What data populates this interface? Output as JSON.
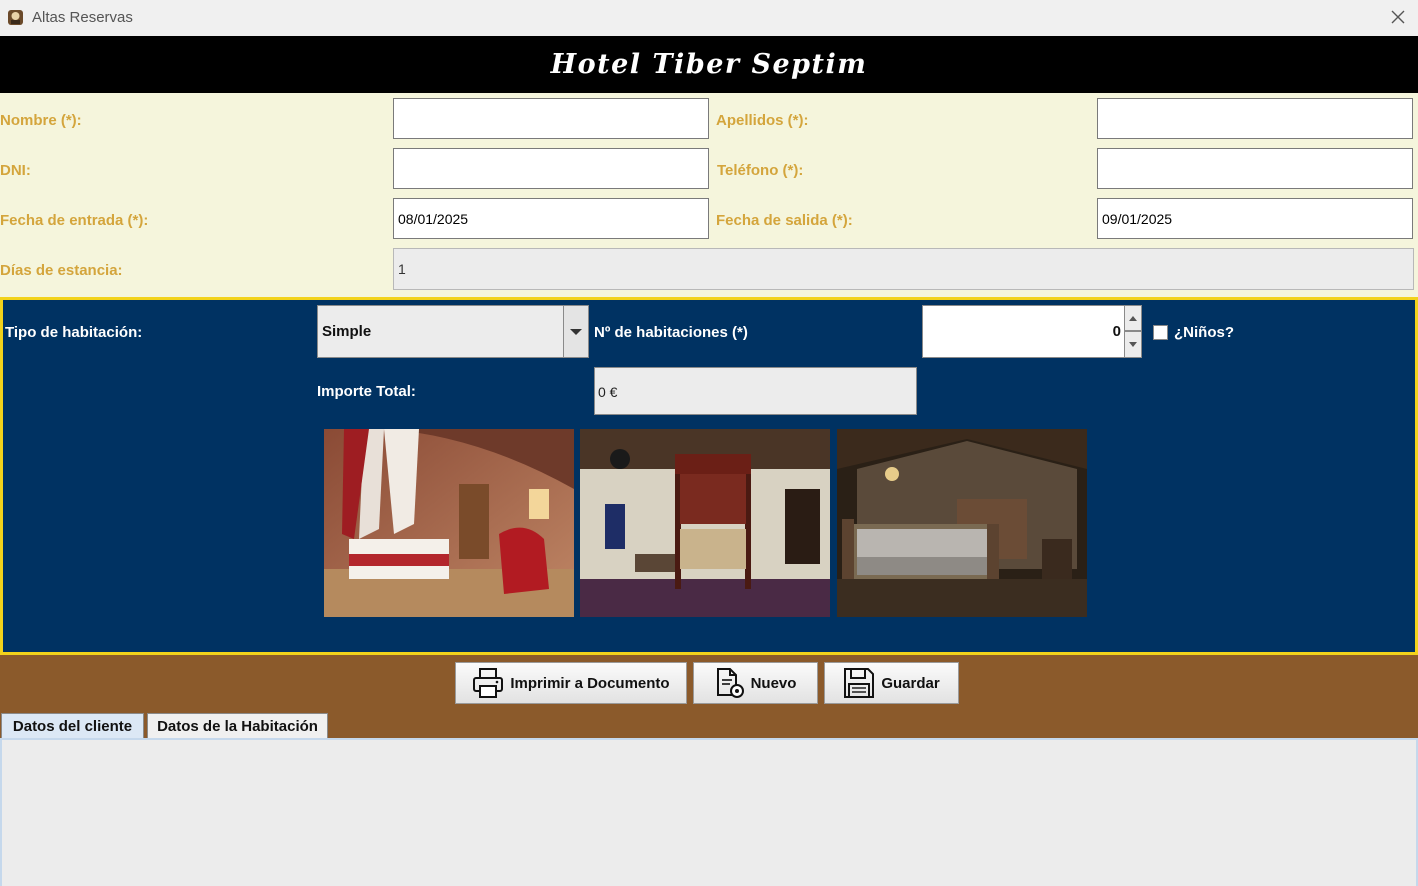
{
  "window": {
    "title": "Altas Reservas"
  },
  "header": {
    "hotel_name": "Hotel Tiber Septim"
  },
  "client": {
    "nombre_label": "Nombre (*):",
    "nombre_value": "",
    "apellidos_label": "Apellidos (*):",
    "apellidos_value": "",
    "dni_label": "DNI:",
    "dni_value": "",
    "telefono_label": "Teléfono (*):",
    "telefono_value": "",
    "fecha_entrada_label": "Fecha de entrada (*):",
    "fecha_entrada_value": "08/01/2025",
    "fecha_salida_label": "Fecha de salida (*):",
    "fecha_salida_value": "09/01/2025",
    "dias_label": "Días de estancia:",
    "dias_value": "1"
  },
  "room": {
    "tipo_label": "Tipo de habitación:",
    "tipo_value": "Simple",
    "num_label": "Nº de habitaciones (*)",
    "num_value": "0",
    "ninos_label": "¿Niños?",
    "ninos_checked": false,
    "importe_label": "Importe Total:",
    "importe_value": "0 €"
  },
  "buttons": {
    "print_label": "Imprimir a Documento",
    "new_label": "Nuevo",
    "save_label": "Guardar"
  },
  "tabs": [
    {
      "label": "Datos del cliente",
      "active": true
    },
    {
      "label": "Datos de la Habitación",
      "active": false
    }
  ],
  "colors": {
    "header_bg": "#000000",
    "client_panel_bg": "#f5f5dc",
    "client_label": "#d4a53c",
    "room_panel_bg": "#003262",
    "room_panel_border": "#f2d21b",
    "button_area_bg": "#8b5a2b"
  }
}
